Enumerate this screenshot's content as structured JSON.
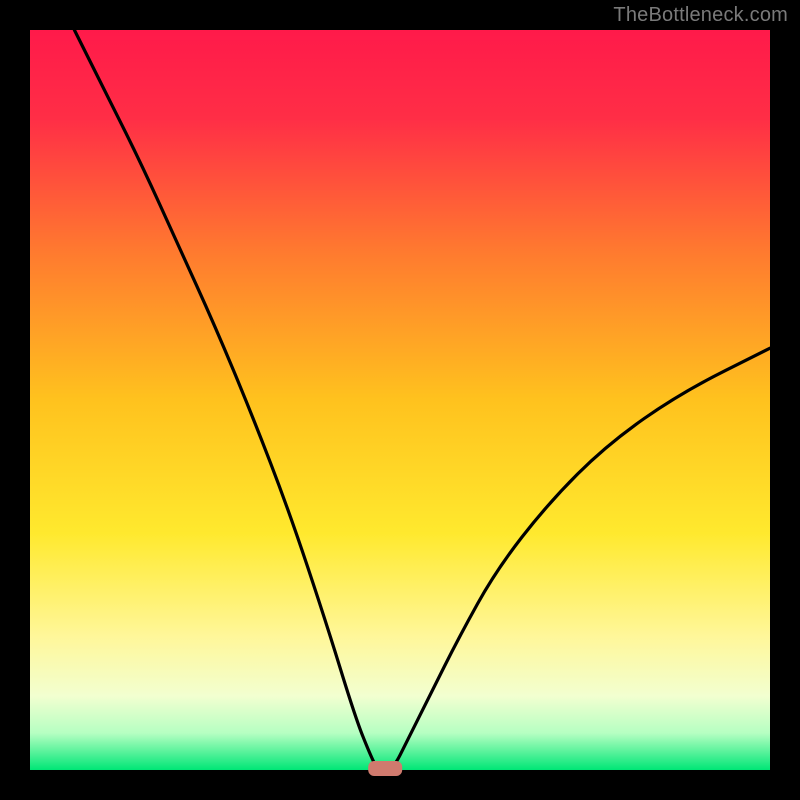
{
  "watermark": "TheBottleneck.com",
  "chart_data": {
    "type": "line",
    "title": "",
    "xlabel": "",
    "ylabel": "",
    "xlim": [
      0,
      100
    ],
    "ylim": [
      0,
      100
    ],
    "grid": false,
    "background_gradient": {
      "top_color": "#ff1a4a",
      "mid_color": "#ffd600",
      "low_color": "#ffffb0",
      "bottom_color": "#00e676"
    },
    "marker": {
      "x": 48,
      "y": 0,
      "color": "#d07a6e",
      "shape": "rounded-rect"
    },
    "series": [
      {
        "name": "left-curve",
        "x": [
          6,
          10,
          15,
          20,
          25,
          30,
          35,
          40,
          44,
          46,
          47
        ],
        "y": [
          100,
          92,
          82,
          71,
          60,
          48,
          35,
          20,
          7,
          2,
          0
        ]
      },
      {
        "name": "right-curve",
        "x": [
          49,
          51,
          54,
          58,
          63,
          70,
          78,
          88,
          100
        ],
        "y": [
          0,
          4,
          10,
          18,
          27,
          36,
          44,
          51,
          57
        ]
      }
    ]
  }
}
